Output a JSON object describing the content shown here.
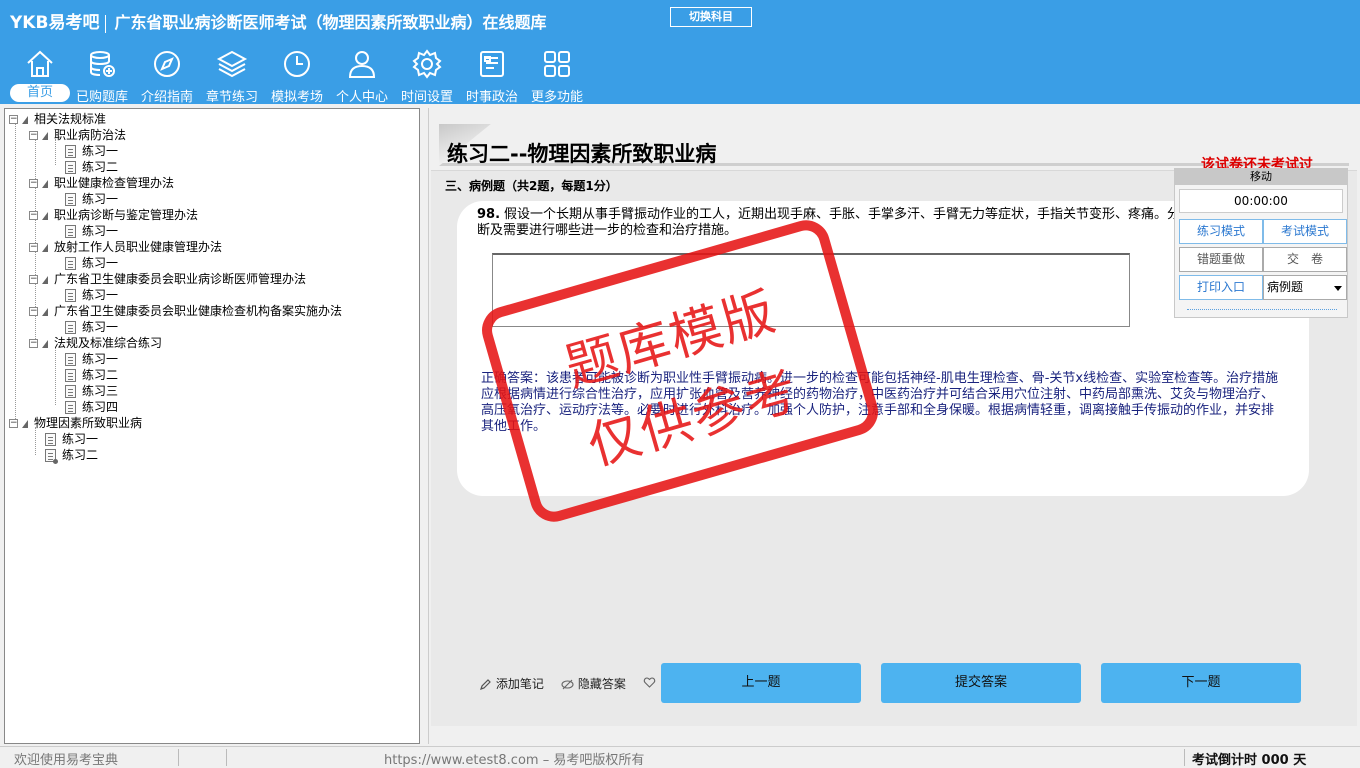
{
  "header": {
    "logo": "YKB易考吧",
    "title": "广东省职业病诊断医师考试（物理因素所致职业病）在线题库",
    "switch_label": "切换科目"
  },
  "nav": [
    {
      "label": "首页",
      "icon": "home-icon",
      "active": true
    },
    {
      "label": "已购题库",
      "icon": "database-icon"
    },
    {
      "label": "介绍指南",
      "icon": "compass-icon"
    },
    {
      "label": "章节练习",
      "icon": "layers-icon"
    },
    {
      "label": "模拟考场",
      "icon": "clock-icon"
    },
    {
      "label": "个人中心",
      "icon": "user-icon"
    },
    {
      "label": "时间设置",
      "icon": "gear-icon"
    },
    {
      "label": "时事政治",
      "icon": "news-icon"
    },
    {
      "label": "更多功能",
      "icon": "grid-icon"
    }
  ],
  "tree": {
    "root1": "相关法规标准",
    "groups": [
      {
        "label": "职业病防治法",
        "items": [
          "练习一",
          "练习二"
        ]
      },
      {
        "label": "职业健康检查管理办法",
        "items": [
          "练习一"
        ]
      },
      {
        "label": "职业病诊断与鉴定管理办法",
        "items": [
          "练习一"
        ]
      },
      {
        "label": "放射工作人员职业健康管理办法",
        "items": [
          "练习一"
        ]
      },
      {
        "label": "广东省卫生健康委员会职业病诊断医师管理办法",
        "items": [
          "练习一"
        ]
      },
      {
        "label": "广东省卫生健康委员会职业健康检查机构备案实施办法",
        "items": [
          "练习一"
        ]
      },
      {
        "label": "法规及标准综合练习",
        "items": [
          "练习一",
          "练习二",
          "练习三",
          "练习四"
        ]
      }
    ],
    "root2": "物理因素所致职业病",
    "root2_items": [
      "练习一",
      "练习二"
    ]
  },
  "main": {
    "paper_title": "练习二--物理因素所致职业病",
    "status": "该试卷还未考试过",
    "section": "三、病例题（共2题，每题1分）",
    "question_number": "98.",
    "question": "假设一个长期从事手臂振动作业的工人，近期出现手麻、手胀、手掌多汗、手臂无力等症状，手指关节变形、疼痛。分析该患者可能的诊断及需要进行哪些进一步的检查和治疗措施。",
    "answer": "正确答案：该患者可能被诊断为职业性手臂振动病。进一步的检查可能包括神经-肌电生理检查、骨-关节x线检查、实验室检查等。治疗措施应根据病情进行综合性治疗，应用扩张血管及营养神经的药物治疗，中医药治疗并可结合采用穴位注射、中药局部熏洗、艾灸与物理治疗、高压氧治疗、运动疗法等。必要时进行外科治疗。加强个人防护，注意手部和全身保暖。根据病情轻重，调离接触手传振动的作业，并安排其他工作。",
    "stamp_line1": "题库模版",
    "stamp_line2": "仅供参考",
    "add_note": "添加笔记",
    "hide_answer": "隐藏答案",
    "prev": "上一题",
    "submit": "提交答案",
    "next": "下一题"
  },
  "panel": {
    "move": "移动",
    "timer": "00:00:00",
    "practice_mode": "练习模式",
    "exam_mode": "考试模式",
    "redo_wrong": "错题重做",
    "hand_in": "交　卷",
    "print": "打印入口",
    "type_select": "病例题"
  },
  "status": {
    "welcome": "欢迎使用易考宝典",
    "copyright": "https://www.etest8.com – 易考吧版权所有",
    "countdown": "考试倒计时 000 天"
  }
}
